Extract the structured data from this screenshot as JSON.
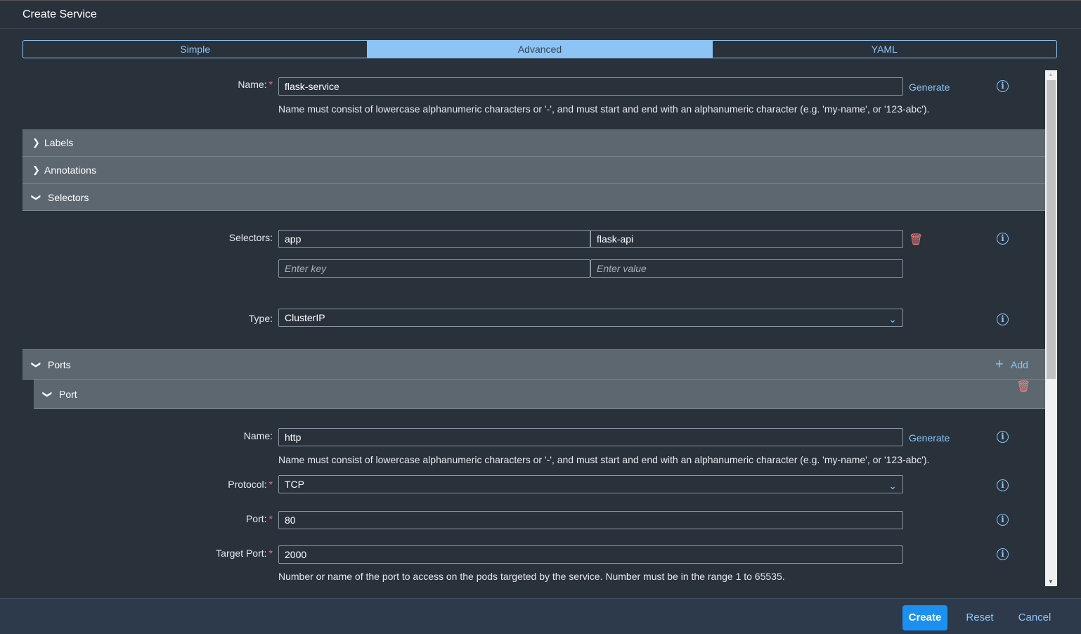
{
  "title": "Create Service",
  "tabs": [
    "Simple",
    "Advanced",
    "YAML"
  ],
  "active_tab": "Advanced",
  "name": {
    "label": "Name:",
    "value": "flask-service",
    "generate": "Generate",
    "help": "Name must consist of lowercase alphanumeric characters or '-', and must start and end with an alphanumeric character (e.g. 'my-name', or '123-abc')."
  },
  "sections": {
    "labels": "Labels",
    "annotations": "Annotations",
    "selectors": "Selectors",
    "ports": "Ports",
    "port": "Port"
  },
  "selectors": {
    "label": "Selectors:",
    "key": "app",
    "value": "flask-api",
    "key_placeholder": "Enter key",
    "value_placeholder": "Enter value"
  },
  "type": {
    "label": "Type:",
    "value": "ClusterIP"
  },
  "ports_add": "Add",
  "port": {
    "name_label": "Name:",
    "name_value": "http",
    "generate": "Generate",
    "name_help": "Name must consist of lowercase alphanumeric characters or '-', and must start and end with an alphanumeric character (e.g. 'my-name', or '123-abc').",
    "protocol_label": "Protocol:",
    "protocol_value": "TCP",
    "port_label": "Port:",
    "port_value": "80",
    "target_label": "Target Port:",
    "target_value": "2000",
    "target_help": "Number or name of the port to access on the pods targeted by the service. Number must be in the range 1 to 65535."
  },
  "footer": {
    "create": "Create",
    "reset": "Reset",
    "cancel": "Cancel"
  },
  "colors": {
    "accent": "#8cc4f5",
    "primary": "#1b90f0",
    "danger": "#f08080"
  }
}
